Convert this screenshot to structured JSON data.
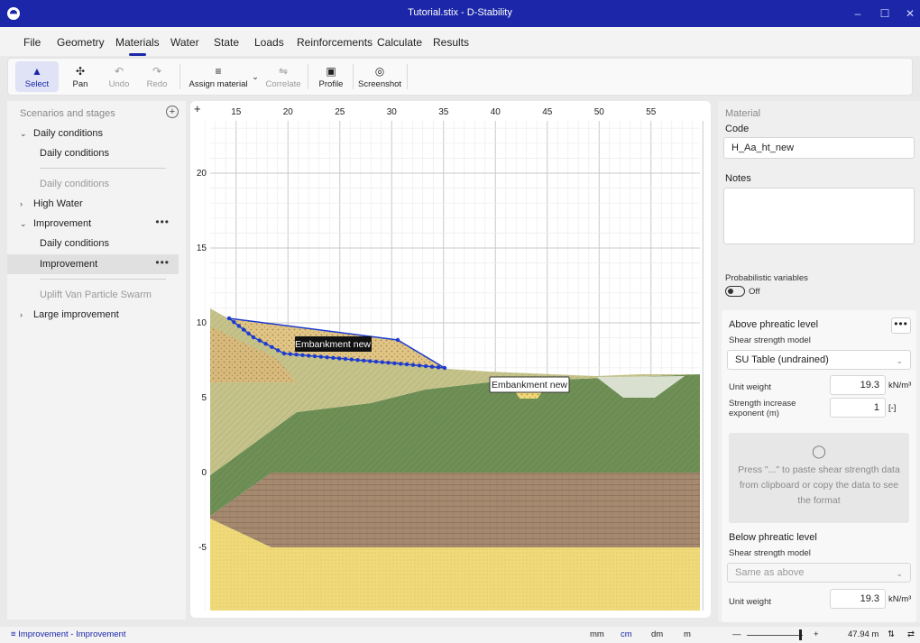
{
  "window": {
    "title": "Tutorial.stix - D-Stability",
    "minimize": "–",
    "maximize": "☐",
    "close": "✕"
  },
  "menu": [
    "File",
    "Geometry",
    "Materials",
    "Water",
    "State",
    "Loads",
    "Reinforcements",
    "Calculate",
    "Results"
  ],
  "menu_active": "Materials",
  "toolbar": {
    "select": "Select",
    "pan": "Pan",
    "undo": "Undo",
    "redo": "Redo",
    "assign_material": "Assign material",
    "correlate": "Correlate",
    "profile": "Profile",
    "screenshot": "Screenshot"
  },
  "scenarios": {
    "header": "Scenarios and stages",
    "items": [
      {
        "label": "Daily conditions",
        "kind": "scenario",
        "expanded": true
      },
      {
        "label": "Daily conditions",
        "kind": "stage"
      },
      {
        "label": "Daily conditions",
        "kind": "calculation"
      },
      {
        "label": "High Water",
        "kind": "scenario",
        "expanded": false
      },
      {
        "label": "Improvement",
        "kind": "scenario",
        "expanded": true
      },
      {
        "label": "Daily conditions",
        "kind": "stage"
      },
      {
        "label": "Improvement",
        "kind": "stage",
        "selected": true
      },
      {
        "label": "Uplift Van Particle Swarm",
        "kind": "calculation"
      },
      {
        "label": "Large improvement",
        "kind": "scenario",
        "expanded": false
      }
    ],
    "more": "•••"
  },
  "canvas": {
    "plus": "+",
    "x_ticks": [
      "15",
      "20",
      "25",
      "30",
      "35",
      "40",
      "45",
      "50",
      "55"
    ],
    "y_ticks": [
      "20",
      "15",
      "10",
      "5",
      "0",
      "-5"
    ],
    "labels": {
      "embankment_selected": "Embankment new",
      "embankment_hover": "Embankment new"
    }
  },
  "material": {
    "section": "Material",
    "code_label": "Code",
    "code_value": "H_Aa_ht_new",
    "notes_label": "Notes",
    "notes_value": "",
    "prob_label": "Probabilistic variables",
    "prob_state": "Off",
    "above": {
      "title": "Above phreatic level",
      "model_label": "Shear strength model",
      "model_value": "SU Table (undrained)",
      "unit_weight_label": "Unit weight",
      "unit_weight_value": "19.3",
      "unit_weight_unit": "kN/m³",
      "strength_label_1": "Strength increase",
      "strength_label_2": "exponent (m)",
      "strength_value": "1",
      "strength_unit": "[-]",
      "hint_lines": [
        "Press \"...\" to paste shear strength data",
        "from clipboard or copy the data to see",
        "the format"
      ]
    },
    "below": {
      "title": "Below phreatic level",
      "model_label": "Shear strength model",
      "model_value": "Same as above",
      "unit_weight_label": "Unit weight",
      "unit_weight_value": "19.3",
      "unit_weight_unit": "kN/m³"
    },
    "more": "•••"
  },
  "status": {
    "breadcrumb": "Improvement - Improvement",
    "units": [
      "mm",
      "cm",
      "dm",
      "m"
    ],
    "active_unit": "cm",
    "zoom_minus": "—",
    "zoom_plus": "+",
    "scale": "47.94 m"
  },
  "colors": {
    "accent": "#1b27a8",
    "clay_green": "#6e8f55",
    "peat_brown": "#a58a6f",
    "sand_yellow": "#f0d978",
    "embankment": "#d8bb7c",
    "loam": "#c5c38a"
  }
}
